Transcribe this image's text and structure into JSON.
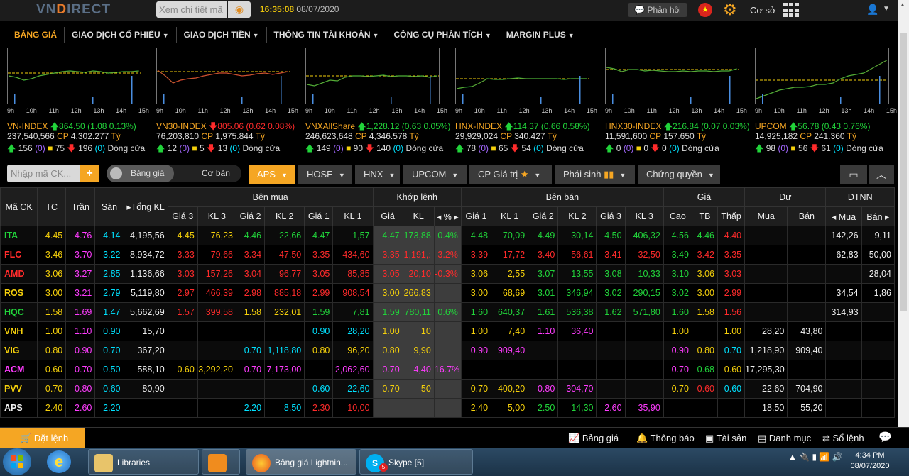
{
  "header": {
    "logo_left": "VN",
    "logo_d": "D",
    "logo_right": "IRECT",
    "search_placeholder": "Xem chi tiết mã",
    "time": "16:35:08",
    "date": "08/07/2020",
    "feedback": "Phản hồi",
    "account_mode": "Cơ sở"
  },
  "menu": [
    {
      "label": "BẢNG GIÁ",
      "active": true
    },
    {
      "label": "GIAO DỊCH CỔ PHIẾU",
      "caret": true
    },
    {
      "label": "GIAO DỊCH TIỀN",
      "caret": true
    },
    {
      "label": "THÔNG TIN TÀI KHOẢN",
      "caret": true
    },
    {
      "label": "CÔNG CỤ PHÂN TÍCH",
      "caret": true
    },
    {
      "label": "MARGIN PLUS",
      "caret": true
    }
  ],
  "hours": [
    "9h",
    "10h",
    "11h",
    "12h",
    "13h",
    "14h",
    "15h"
  ],
  "indices": [
    {
      "name": "VN-INDEX",
      "dir": "up",
      "value": "864.50",
      "change": "(1.08 0.13%)",
      "volume": "237,540,566",
      "cp": "CP",
      "value_ty": "4,302.277",
      "ty": "Tỷ",
      "up": "156",
      "ceil": "(0)",
      "ref": "75",
      "down": "196",
      "floor": "(0)",
      "close": "Đóng cửa",
      "color": "#21d33a"
    },
    {
      "name": "VN30-INDEX",
      "dir": "down",
      "value": "805.06",
      "change": "(0.62 0.08%)",
      "volume": "76,203,810",
      "cp": "CP",
      "value_ty": "1,975.844",
      "ty": "Tỷ",
      "up": "12",
      "ceil": "(0)",
      "ref": "5",
      "down": "13",
      "floor": "(0)",
      "close": "Đóng cửa",
      "color": "#ff2b2b"
    },
    {
      "name": "VNXAllShare",
      "dir": "up",
      "value": "1,228.12",
      "change": "(0.63 0.05%)",
      "volume": "246,623,648",
      "cp": "CP",
      "value_ty": "4,346.578",
      "ty": "Tỷ",
      "up": "149",
      "ceil": "(0)",
      "ref": "90",
      "down": "140",
      "floor": "(0)",
      "close": "Đóng cửa",
      "color": "#21d33a"
    },
    {
      "name": "HNX-INDEX",
      "dir": "up",
      "value": "114.37",
      "change": "(0.66 0.58%)",
      "volume": "29,929,024",
      "cp": "CP",
      "value_ty": "340.427",
      "ty": "Tỷ",
      "up": "78",
      "ceil": "(0)",
      "ref": "65",
      "down": "54",
      "floor": "(0)",
      "close": "Đóng cửa",
      "color": "#21d33a"
    },
    {
      "name": "HNX30-INDEX",
      "dir": "up",
      "value": "216.84",
      "change": "(0.07 0.03%)",
      "volume": "11,591,600",
      "cp": "CP",
      "value_ty": "157.650",
      "ty": "Tỷ",
      "up": "0",
      "ceil": "(0)",
      "ref": "0",
      "down": "0",
      "floor": "(0)",
      "close": "Đóng cửa",
      "color": "#21d33a"
    },
    {
      "name": "UPCOM",
      "dir": "up",
      "value": "56.78",
      "change": "(0.43 0.76%)",
      "volume": "14,925,182",
      "cp": "CP",
      "value_ty": "241.360",
      "ty": "Tỷ",
      "up": "98",
      "ceil": "(0)",
      "ref": "56",
      "down": "61",
      "floor": "(0)",
      "close": "Đóng cửa",
      "color": "#21d33a"
    }
  ],
  "filter": {
    "code_placeholder": "Nhập mã CK...",
    "add": "+",
    "toggle_on": "Bảng giá",
    "toggle_off": "Cơ bản",
    "tabs": [
      {
        "label": "APS",
        "active": true
      },
      {
        "label": "HOSE"
      },
      {
        "label": "HNX"
      },
      {
        "label": "UPCOM"
      },
      {
        "label": "CP Giá trị"
      },
      {
        "label": "Phái sinh"
      },
      {
        "label": "Chứng quyền"
      }
    ]
  },
  "table": {
    "groups": {
      "buy": "Bên mua",
      "match": "Khớp lệnh",
      "sell": "Bên bán",
      "price": "Giá",
      "remaining": "Dư",
      "foreign": "ĐTNN"
    },
    "headers": [
      "Mã CK",
      "TC",
      "Trần",
      "Sàn",
      "Tổng KL",
      "Giá 3",
      "KL 3",
      "Giá 2",
      "KL 2",
      "Giá 1",
      "KL 1",
      "Giá",
      "KL",
      "%",
      "Giá 1",
      "KL 1",
      "Giá 2",
      "KL 2",
      "Giá 3",
      "KL 3",
      "Cao",
      "TB",
      "Thấp",
      "Mua",
      "Bán",
      "Mua",
      "Bán"
    ],
    "rows": [
      {
        "c": [
          "ITA",
          "4.45",
          "4.76",
          "4.14",
          "4,195,56",
          "4.45",
          "76,23",
          "4.46",
          "22,66",
          "4.47",
          "1,57",
          "4.47",
          "173,88",
          "0.4%",
          "4.48",
          "70,09",
          "4.49",
          "30,14",
          "4.50",
          "406,32",
          "4.56",
          "4.46",
          "4.40",
          "",
          "",
          "142,26",
          "9,11"
        ],
        "k": [
          "g",
          "y",
          "p",
          "c",
          "w",
          "y",
          "y",
          "g",
          "g",
          "g",
          "g",
          "g",
          "g",
          "g",
          "g",
          "g",
          "g",
          "g",
          "g",
          "g",
          "g",
          "g",
          "r",
          "w",
          "w",
          "w",
          "w"
        ]
      },
      {
        "c": [
          "FLC",
          "3.46",
          "3.70",
          "3.22",
          "8,934,72",
          "3.33",
          "79,66",
          "3.34",
          "47,50",
          "3.35",
          "434,60",
          "3.35",
          "1,191,:",
          "-3.2%",
          "3.39",
          "17,72",
          "3.40",
          "56,61",
          "3.41",
          "32,50",
          "3.49",
          "3.42",
          "3.35",
          "",
          "",
          "62,83",
          "50,00"
        ],
        "k": [
          "r",
          "y",
          "p",
          "c",
          "w",
          "r",
          "r",
          "r",
          "r",
          "r",
          "r",
          "r",
          "r",
          "r",
          "r",
          "r",
          "r",
          "r",
          "r",
          "r",
          "g",
          "r",
          "r",
          "w",
          "w",
          "w",
          "w"
        ]
      },
      {
        "c": [
          "AMD",
          "3.06",
          "3.27",
          "2.85",
          "1,136,66",
          "3.03",
          "157,26",
          "3.04",
          "96,77",
          "3.05",
          "85,85",
          "3.05",
          "20,10",
          "-0.3%",
          "3.06",
          "2,55",
          "3.07",
          "13,55",
          "3.08",
          "10,33",
          "3.10",
          "3.06",
          "3.03",
          "",
          "",
          "",
          "28,04"
        ],
        "k": [
          "r",
          "y",
          "p",
          "c",
          "w",
          "r",
          "r",
          "r",
          "r",
          "r",
          "r",
          "r",
          "r",
          "r",
          "y",
          "y",
          "g",
          "g",
          "g",
          "g",
          "g",
          "y",
          "r",
          "w",
          "w",
          "w",
          "w"
        ]
      },
      {
        "c": [
          "ROS",
          "3.00",
          "3.21",
          "2.79",
          "5,119,80",
          "2.97",
          "466,39",
          "2.98",
          "885,18",
          "2.99",
          "908,54",
          "3.00",
          "266,83",
          "",
          "3.00",
          "68,69",
          "3.01",
          "346,94",
          "3.02",
          "290,15",
          "3.02",
          "3.00",
          "2.99",
          "",
          "",
          "34,54",
          "1,86"
        ],
        "k": [
          "y",
          "y",
          "p",
          "c",
          "w",
          "r",
          "r",
          "r",
          "r",
          "r",
          "r",
          "y",
          "y",
          "y",
          "y",
          "y",
          "g",
          "g",
          "g",
          "g",
          "g",
          "y",
          "r",
          "w",
          "w",
          "w",
          "w"
        ]
      },
      {
        "c": [
          "HQC",
          "1.58",
          "1.69",
          "1.47",
          "5,662,69",
          "1.57",
          "399,58",
          "1.58",
          "232,01",
          "1.59",
          "7,81",
          "1.59",
          "780,11",
          "0.6%",
          "1.60",
          "640,37",
          "1.61",
          "536,38",
          "1.62",
          "571,80",
          "1.60",
          "1.58",
          "1.56",
          "",
          "",
          "314,93",
          ""
        ],
        "k": [
          "g",
          "y",
          "p",
          "c",
          "w",
          "r",
          "r",
          "y",
          "y",
          "g",
          "g",
          "g",
          "g",
          "g",
          "g",
          "g",
          "g",
          "g",
          "g",
          "g",
          "g",
          "y",
          "r",
          "w",
          "w",
          "w",
          "w"
        ]
      },
      {
        "c": [
          "VNH",
          "1.00",
          "1.10",
          "0.90",
          "15,70",
          "",
          "",
          "",
          "",
          "0.90",
          "28,20",
          "1.00",
          "10",
          "",
          "1.00",
          "7,40",
          "1.10",
          "36,40",
          "",
          "",
          "1.00",
          "",
          "1.00",
          "28,20",
          "43,80",
          "",
          ""
        ],
        "k": [
          "y",
          "y",
          "p",
          "c",
          "w",
          "w",
          "w",
          "w",
          "w",
          "c",
          "c",
          "y",
          "y",
          "y",
          "y",
          "y",
          "p",
          "p",
          "w",
          "w",
          "y",
          "w",
          "y",
          "w",
          "w",
          "w",
          "w"
        ]
      },
      {
        "c": [
          "VIG",
          "0.80",
          "0.90",
          "0.70",
          "367,20",
          "",
          "",
          "0.70",
          "1,118,80",
          "0.80",
          "96,20",
          "0.80",
          "9,90",
          "",
          "0.90",
          "909,40",
          "",
          "",
          "",
          "",
          "0.90",
          "0.80",
          "0.70",
          "1,218,90",
          "909,40",
          "",
          ""
        ],
        "k": [
          "y",
          "y",
          "p",
          "c",
          "w",
          "w",
          "w",
          "c",
          "c",
          "y",
          "y",
          "y",
          "y",
          "y",
          "p",
          "p",
          "w",
          "w",
          "w",
          "w",
          "p",
          "y",
          "c",
          "w",
          "w",
          "w",
          "w"
        ]
      },
      {
        "c": [
          "ACM",
          "0.60",
          "0.70",
          "0.50",
          "588,10",
          "0.60",
          "3,292,20",
          "0.70",
          "7,173,00",
          "",
          "2,062,60",
          "0.70",
          "4,40",
          "16.7%",
          "",
          "",
          "",
          "",
          "",
          "",
          "0.70",
          "0.68",
          "0.60",
          "17,295,30",
          "",
          "",
          ""
        ],
        "k": [
          "p",
          "y",
          "p",
          "c",
          "w",
          "y",
          "y",
          "p",
          "p",
          "p",
          "p",
          "p",
          "p",
          "p",
          "w",
          "w",
          "w",
          "w",
          "w",
          "w",
          "p",
          "g",
          "y",
          "w",
          "w",
          "w",
          "w"
        ]
      },
      {
        "c": [
          "PVV",
          "0.70",
          "0.80",
          "0.60",
          "80,90",
          "",
          "",
          "",
          "",
          "0.60",
          "22,60",
          "0.70",
          "50",
          "",
          "0.70",
          "400,20",
          "0.80",
          "304,70",
          "",
          "",
          "0.70",
          "0.60",
          "0.60",
          "22,60",
          "704,90",
          "",
          ""
        ],
        "k": [
          "y",
          "y",
          "p",
          "c",
          "w",
          "w",
          "w",
          "w",
          "w",
          "c",
          "c",
          "y",
          "y",
          "y",
          "y",
          "y",
          "p",
          "p",
          "w",
          "w",
          "y",
          "r",
          "c",
          "w",
          "w",
          "w",
          "w"
        ]
      },
      {
        "c": [
          "APS",
          "2.40",
          "2.60",
          "2.20",
          "",
          "",
          "",
          "2.20",
          "8,50",
          "2.30",
          "10,00",
          "",
          "",
          "",
          "2.40",
          "5,00",
          "2.50",
          "14,30",
          "2.60",
          "35,90",
          "",
          "",
          "",
          "18,50",
          "55,20",
          "",
          ""
        ],
        "k": [
          "w",
          "y",
          "p",
          "c",
          "w",
          "w",
          "w",
          "c",
          "c",
          "r",
          "r",
          "w",
          "w",
          "w",
          "y",
          "y",
          "g",
          "g",
          "p",
          "p",
          "w",
          "w",
          "w",
          "w",
          "w",
          "w",
          "w"
        ]
      }
    ]
  },
  "bottom": {
    "order": "Đặt lệnh",
    "links": [
      "Bảng giá",
      "Thông báo",
      "Tài sản",
      "Danh mục",
      "Sổ lệnh"
    ]
  },
  "taskbar": {
    "items": [
      "Libraries",
      "Bảng giá Lightnin...",
      "Skype [5]"
    ],
    "skype_badge": "5",
    "time": "4:34 PM",
    "date": "08/07/2020"
  },
  "colors": {
    "accent": "#f5a623",
    "up": "#21d33a",
    "down": "#ff2b2b",
    "ref": "#f5d00b",
    "ceil": "#ff3cff",
    "floor": "#00e1ff"
  }
}
